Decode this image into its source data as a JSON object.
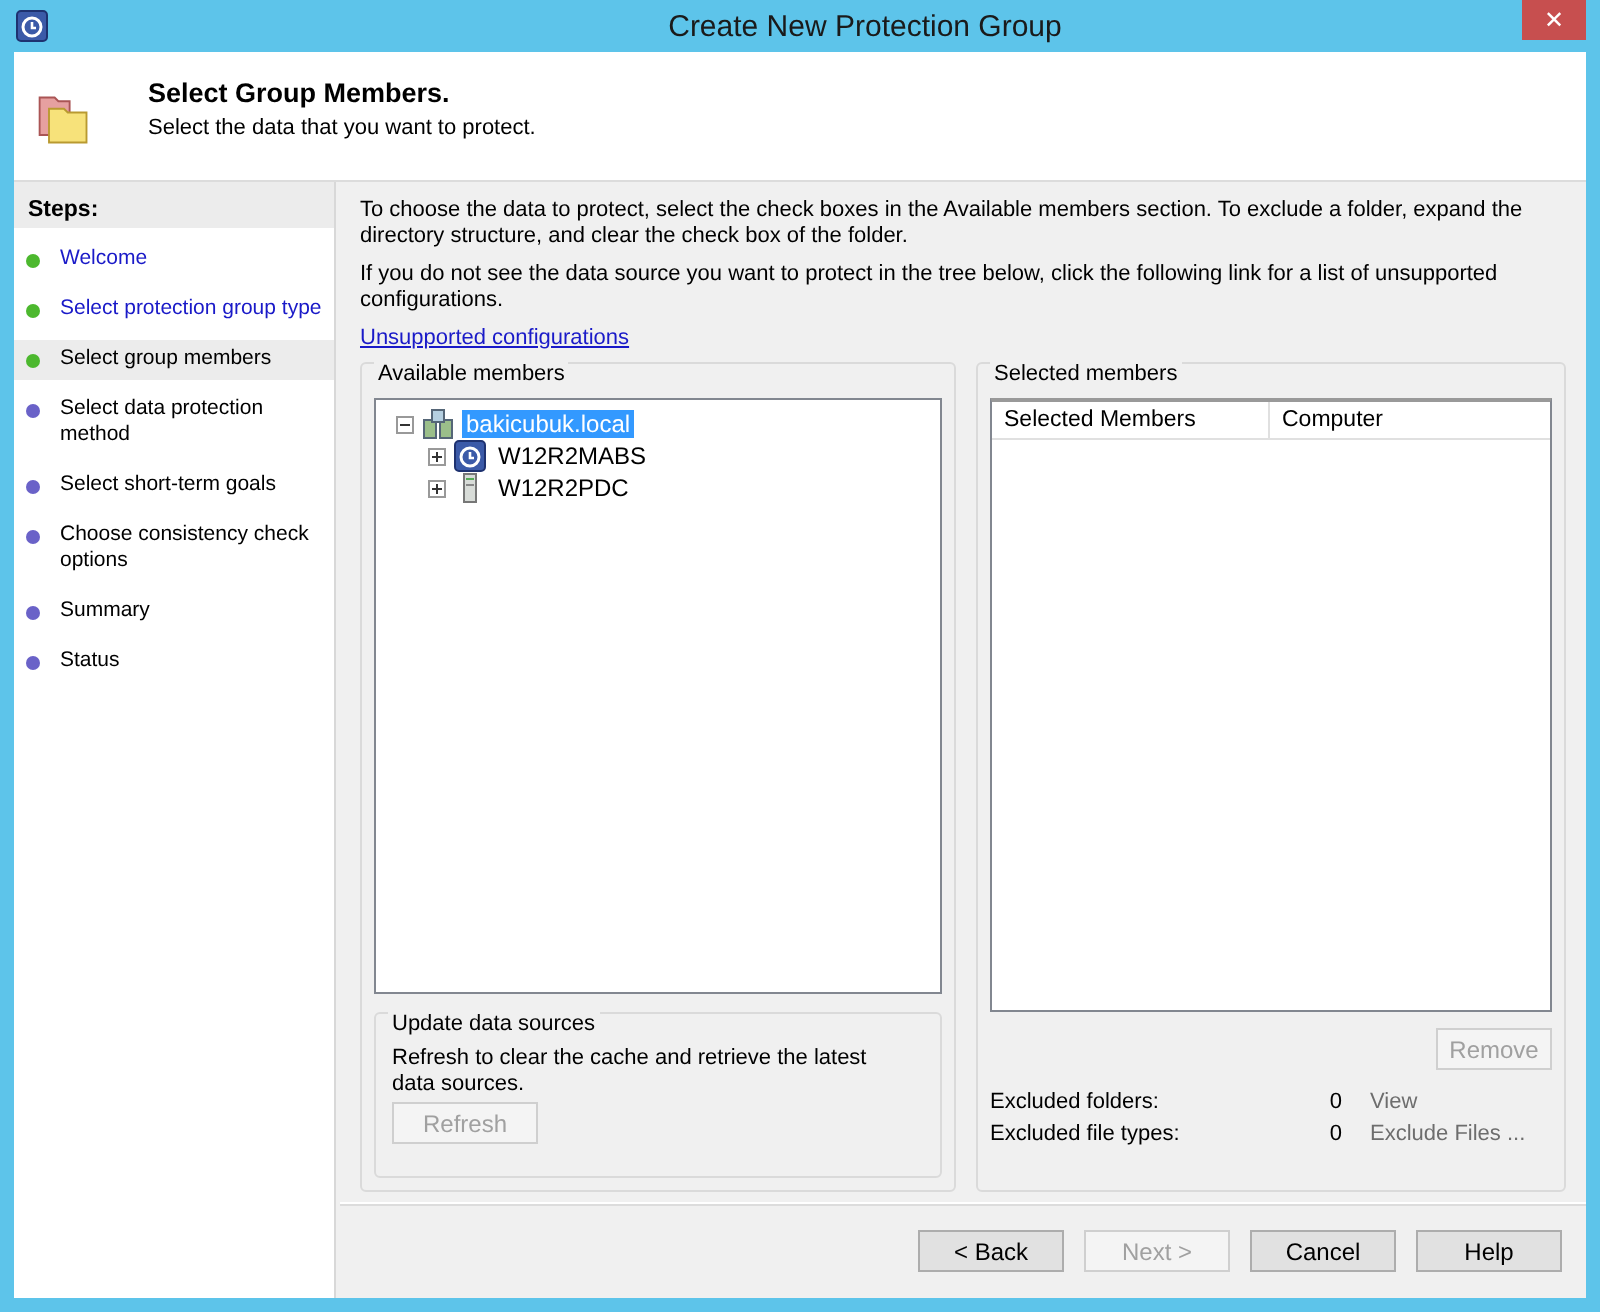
{
  "window": {
    "title": "Create New Protection Group",
    "close": "✕"
  },
  "header": {
    "title": "Select Group Members.",
    "subtitle": "Select the data that you want to protect."
  },
  "steps": {
    "heading": "Steps:",
    "items": [
      {
        "label": "Welcome",
        "done": true,
        "selected": false
      },
      {
        "label": "Select protection group type",
        "done": true,
        "selected": false
      },
      {
        "label": "Select group members",
        "done": true,
        "selected": true
      },
      {
        "label": "Select data protection method",
        "done": false,
        "selected": false
      },
      {
        "label": "Select short-term goals",
        "done": false,
        "selected": false
      },
      {
        "label": "Choose consistency check options",
        "done": false,
        "selected": false
      },
      {
        "label": "Summary",
        "done": false,
        "selected": false
      },
      {
        "label": "Status",
        "done": false,
        "selected": false
      }
    ]
  },
  "intro": [
    "To choose the data to protect, select the check boxes in the Available members section. To exclude a folder, expand the directory structure, and clear the check box of the folder.",
    "If you do not see the data source you want to protect in the tree below, click the following link for a list of unsupported configurations."
  ],
  "link": "Unsupported configurations",
  "available": {
    "title": "Available members",
    "tree": [
      {
        "label": "bakicubuk.local",
        "kind": "domain",
        "expanded": true,
        "selected": true,
        "children": [
          {
            "label": "W12R2MABS",
            "kind": "backup-server",
            "expanded": false,
            "selected": false
          },
          {
            "label": "W12R2PDC",
            "kind": "server",
            "expanded": false,
            "selected": false
          }
        ]
      }
    ]
  },
  "update": {
    "title": "Update data sources",
    "text": "Refresh to clear the cache and retrieve the latest data sources.",
    "button": {
      "label": "Refresh",
      "disabled": true
    }
  },
  "selected_members": {
    "title": "Selected members",
    "columns": [
      "Selected Members",
      "Computer"
    ],
    "remove": {
      "label": "Remove",
      "disabled": true
    },
    "summary": [
      {
        "label": "Excluded folders:",
        "count": "0",
        "action": "View"
      },
      {
        "label": "Excluded file types:",
        "count": "0",
        "action": "Exclude Files ..."
      }
    ]
  },
  "buttons": [
    {
      "label": "< Back",
      "disabled": false
    },
    {
      "label": "Next >",
      "disabled": true
    },
    {
      "label": "Cancel",
      "disabled": false
    },
    {
      "label": "Help",
      "disabled": false
    }
  ]
}
